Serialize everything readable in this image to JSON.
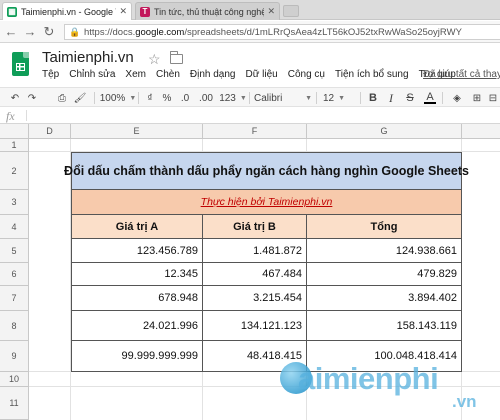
{
  "browser": {
    "tabs": [
      {
        "label": "Taimienphi.vn - Google Trang tính",
        "active": true,
        "favicon_color": "#0f9d58"
      },
      {
        "label": "Tin tức, thủ thuật công nghệ mới nhất",
        "active": false,
        "favicon_color": "#c2185b"
      }
    ],
    "url_prefix": "https://docs.",
    "url_host": "google.com",
    "url_path": "/spreadsheets/d/1mLRrQsAea4zLT56kOJ52txRwWaSo25oyjRWY"
  },
  "doc": {
    "title": "Taimienphi.vn",
    "last_edit": "Đã lưu tất cả thay đổi",
    "menu": [
      "Tệp",
      "Chỉnh sửa",
      "Xem",
      "Chèn",
      "Định dạng",
      "Dữ liệu",
      "Công cụ",
      "Tiện ích bổ sung",
      "Trợ giúp"
    ]
  },
  "toolbar": {
    "zoom": "100%",
    "currency": "₫",
    "percent": "%",
    "dec_decrease": ".0",
    "dec_increase": ".00",
    "format_more": "123",
    "font": "Calibri",
    "font_size": "12",
    "bold": "B",
    "italic": "I",
    "strike": "S",
    "text_color": "A"
  },
  "formula": {
    "fx": "fx"
  },
  "grid": {
    "columns": [
      "D",
      "E",
      "F",
      "G"
    ],
    "rows": [
      "1",
      "2",
      "3",
      "4",
      "5",
      "6",
      "7",
      "8",
      "9",
      "10",
      "11"
    ]
  },
  "table": {
    "title": "Đổi dấu chấm thành dấu phẩy ngăn cách hàng nghìn Google Sheets",
    "subtitle": "Thực hiện bởi Taimienphi.vn",
    "headers": [
      "Giá trị A",
      "Giá trị B",
      "Tổng"
    ],
    "rows": [
      [
        "123.456.789",
        "1.481.872",
        "124.938.661"
      ],
      [
        "12.345",
        "467.484",
        "479.829"
      ],
      [
        "678.948",
        "3.215.454",
        "3.894.402"
      ],
      [
        "24.021.996",
        "134.121.123",
        "158.143.119"
      ],
      [
        "99.999.999.999",
        "48.418.415",
        "100.048.418.414"
      ]
    ],
    "colors": {
      "title_bg": "#c6d6ee",
      "subtitle_bg": "#f7caac",
      "subtitle_text": "#c00000",
      "header_bg": "#fbdfc9"
    }
  },
  "watermark": {
    "text": "aimienphi",
    "suffix": ".vn"
  }
}
